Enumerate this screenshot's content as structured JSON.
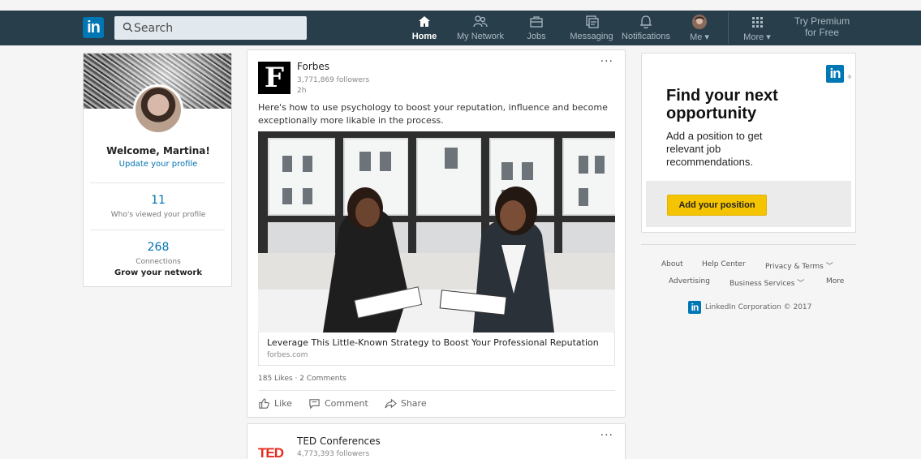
{
  "header": {
    "logo": "in",
    "search_placeholder": "Search",
    "nav": [
      {
        "label": "Home"
      },
      {
        "label": "My Network"
      },
      {
        "label": "Jobs"
      },
      {
        "label": "Messaging"
      },
      {
        "label": "Notifications"
      },
      {
        "label": "Me ▾"
      },
      {
        "label": "More ▾"
      }
    ],
    "premium": {
      "line1": "Try Premium",
      "line2": "for Free"
    }
  },
  "profile": {
    "welcome": "Welcome, Martina!",
    "update": "Update your profile",
    "views_count": "11",
    "views_label": "Who's viewed your profile",
    "connections_count": "268",
    "connections_label": "Connections",
    "grow": "Grow your network"
  },
  "posts": [
    {
      "org": "Forbes",
      "logo_letter": "F",
      "followers": "3,771,869 followers",
      "time": "2h",
      "menu": "···",
      "text": "Here's how to use psychology to boost your reputation, influence and become exceptionally more likable in the process.",
      "link_title": "Leverage This Little-Known Strategy to Boost Your Professional Reputation",
      "link_source": "forbes.com",
      "likes": "185 Likes",
      "sep": "·",
      "comments": "2 Comments",
      "actions": [
        "Like",
        "Comment",
        "Share"
      ]
    },
    {
      "org": "TED Conferences",
      "logo_text": "TED",
      "followers": "4,773,393 followers",
      "menu": "···"
    }
  ],
  "ad": {
    "logo": "in",
    "reg": "®",
    "title": "Find your next opportunity",
    "text": "Add a position to get relevant job recommendations.",
    "button": "Add your position"
  },
  "footer": {
    "links": [
      "About",
      "Help Center",
      "Privacy & Terms ﹀",
      "Advertising",
      "Business Services ﹀",
      "More"
    ],
    "logo": "in",
    "copyright": "LinkedIn Corporation © 2017"
  },
  "colors": {
    "topbar": "#283e4a",
    "brand": "#0077b5",
    "link": "#0073b1",
    "cta": "#f5c400"
  }
}
